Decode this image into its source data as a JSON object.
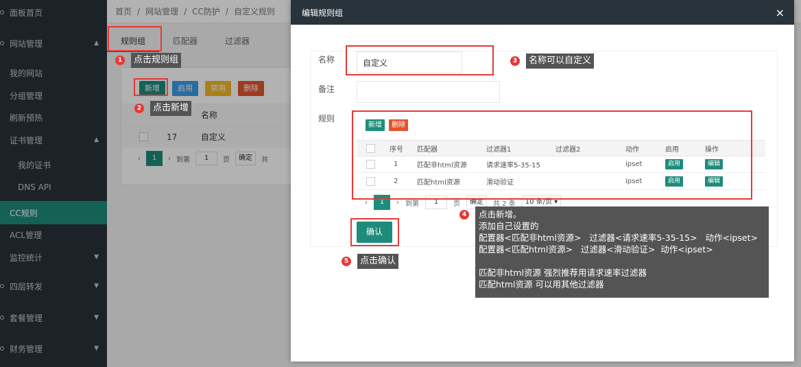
{
  "sidebar": {
    "items": [
      {
        "label": "面板首页",
        "arrow": ""
      },
      {
        "label": "网站管理",
        "arrow": "▲"
      },
      {
        "label": "我的网站",
        "arrow": ""
      },
      {
        "label": "分组管理",
        "arrow": ""
      },
      {
        "label": "刷新预热",
        "arrow": ""
      },
      {
        "label": "证书管理",
        "arrow": "▲"
      },
      {
        "label": "我的证书",
        "arrow": ""
      },
      {
        "label": "DNS API",
        "arrow": ""
      },
      {
        "label": "CC规则",
        "arrow": ""
      },
      {
        "label": "ACL管理",
        "arrow": ""
      },
      {
        "label": "监控统计",
        "arrow": "▼"
      },
      {
        "label": "四层转发",
        "arrow": "▼"
      },
      {
        "label": "套餐管理",
        "arrow": "▼"
      },
      {
        "label": "财务管理",
        "arrow": "▼"
      }
    ]
  },
  "breadcrumb": [
    "首页",
    "/",
    "网站管理",
    "/",
    "CC防护",
    "/",
    "自定义规则"
  ],
  "tabs": [
    "规则组",
    "匹配器",
    "过滤器"
  ],
  "bg": {
    "btn_add": "新增",
    "btn_enable": "启用",
    "btn_disable": "禁用",
    "btn_delete": "删除",
    "col_name": "名称",
    "row_id": "17",
    "row_name": "自定义",
    "pager_page": "1",
    "pager_goto": "到第",
    "pager_input": "1",
    "pager_unit": "页",
    "pager_ok": "确定",
    "pager_total": "共"
  },
  "modal": {
    "title": "编辑规则组",
    "close": "×",
    "name_label": "名称",
    "name_value": "自定义",
    "remark_label": "备注",
    "remark_value": "",
    "rules_label": "规则",
    "btn_add": "新增",
    "btn_delete": "删除",
    "headers": [
      "序号",
      "匹配器",
      "过滤器1",
      "过滤器2",
      "动作",
      "启用",
      "操作"
    ],
    "rows": [
      {
        "no": "1",
        "matcher": "匹配非html资源",
        "f1": "请求速率5-35-15",
        "f2": "",
        "action": "ipset",
        "enable": "启用",
        "op": "编辑"
      },
      {
        "no": "2",
        "matcher": "匹配html资源",
        "f1": "滑动验证",
        "f2": "",
        "action": "ipset",
        "enable": "启用",
        "op": "编辑"
      }
    ],
    "pager": {
      "page": "1",
      "goto": "到第",
      "input": "1",
      "unit": "页",
      "ok": "确定",
      "total": "共 2 条",
      "size": "10 条/页 ▾"
    },
    "confirm": "确认"
  },
  "annotations": {
    "tip1": "点击规则组",
    "tip2": "点击新增",
    "tip3": "名称可以自定义",
    "tip4": "点击新增。\n添加自己设置的\n配置器<匹配非html资源>   过滤器<请求速率5-35-15>   动作<ipset>\n配置器<匹配html资源>   过滤器<滑动验证>  动作<ipset>\n\n匹配非html资源 强烈推荐用请求速率过滤器\n匹配html资源 可以用其他过滤器",
    "tip5": "点击确认",
    "n1": "1",
    "n2": "2",
    "n3": "3",
    "n4": "4",
    "n5": "5"
  },
  "colors": {
    "accent": "#1e8c7b",
    "sidebar": "#28333b",
    "annotation": "#e53935"
  }
}
